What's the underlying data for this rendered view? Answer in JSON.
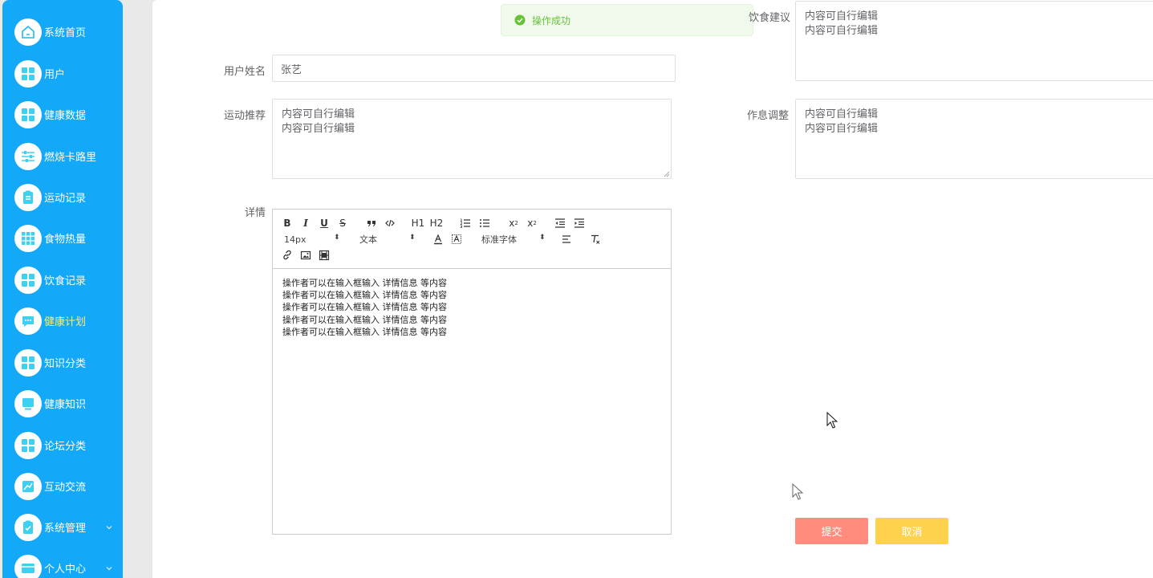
{
  "sidebar": {
    "items": [
      {
        "label": "系统首页",
        "icon": "home-icon"
      },
      {
        "label": "用户",
        "icon": "grid-icon"
      },
      {
        "label": "健康数据",
        "icon": "grid-icon"
      },
      {
        "label": "燃烧卡路里",
        "icon": "sliders-icon"
      },
      {
        "label": "运动记录",
        "icon": "clipboard-icon"
      },
      {
        "label": "食物热量",
        "icon": "grid-dots-icon"
      },
      {
        "label": "饮食记录",
        "icon": "grid-icon"
      },
      {
        "label": "健康计划",
        "icon": "chat-icon"
      },
      {
        "label": "知识分类",
        "icon": "grid-icon"
      },
      {
        "label": "健康知识",
        "icon": "monitor-icon"
      },
      {
        "label": "论坛分类",
        "icon": "grid-icon"
      },
      {
        "label": "互动交流",
        "icon": "chart-icon"
      },
      {
        "label": "系统管理",
        "icon": "checklist-icon"
      },
      {
        "label": "个人中心",
        "icon": "card-icon"
      }
    ],
    "active_color": "#ffee58",
    "background": "#14a9f8"
  },
  "toast": {
    "text": "操作成功",
    "type": "success"
  },
  "form": {
    "username_label": "用户姓名",
    "username_value": "张艺",
    "exercise_label": "运动推荐",
    "exercise_value": "内容可自行编辑\n内容可自行编辑",
    "diet_label": "饮食建议",
    "diet_value": "内容可自行编辑\n内容可自行编辑",
    "schedule_label": "作息调整",
    "schedule_value": "内容可自行编辑\n内容可自行编辑",
    "details_label": "详情"
  },
  "editor": {
    "font_size": "14px",
    "heading_select": "文本",
    "font_family": "标准字体",
    "h1": "H1",
    "h2": "H2",
    "content": "操作者可以在输入框输入  详情信息  等内容\n操作者可以在输入框输入  详情信息  等内容\n操作者可以在输入框输入  详情信息  等内容\n操作者可以在输入框输入  详情信息  等内容\n操作者可以在输入框输入  详情信息  等内容"
  },
  "buttons": {
    "submit": "提交",
    "cancel": "取消",
    "submit_color": "#ff8c7c",
    "cancel_color": "#ffd24d"
  }
}
